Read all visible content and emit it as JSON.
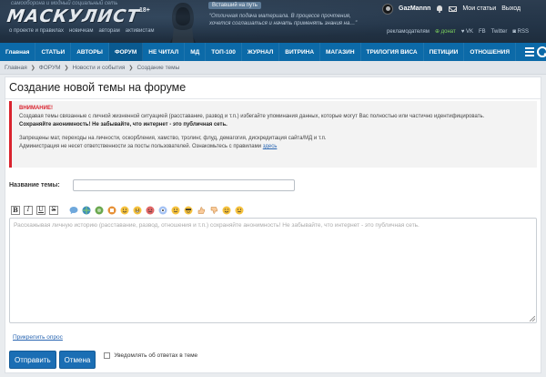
{
  "header": {
    "tagline": "самооборона и модный социальный сеть",
    "logo": "МАСКУЛИСТ",
    "logo_age": "18+",
    "links": [
      "о проекте и правилах",
      "новичкам",
      "авторам",
      "активистам"
    ],
    "quote_badge": "Вставший на путь",
    "quote": "“Отличная подача материала. В процессе прочтения, хочется соглашаться и начать применять знания на…”",
    "user_name": "GazMannn",
    "my_posts": "Мои статьи",
    "logout": "Выход",
    "meta_links": [
      "рекламодателям",
      "донат",
      "VK",
      "FB",
      "Twitter",
      "RSS"
    ]
  },
  "nav": {
    "items": [
      "Главная",
      "СТАТЬИ",
      "АВТОРЫ",
      "ФОРУМ",
      "НЕ ЧИТАЛ",
      "МД",
      "ТОП-100",
      "ЖУРНАЛ",
      "ВИТРИНА",
      "МАГАЗИН",
      "ТРИЛОГИЯ ВИСА",
      "ПЕТИЦИИ",
      "ОТНОШЕНИЯ"
    ],
    "active_index": 3
  },
  "breadcrumb": [
    "Главная",
    "ФОРУМ",
    "Новости и события",
    "Создание темы"
  ],
  "page": {
    "title": "Создание новой темы на форуме"
  },
  "warning": {
    "title": "ВНИМАНИЕ!",
    "line1": "Создавая темы связанные с личной жизненной ситуацией (расставание, развод и т.п.) избегайте упоминания данных, которые могут Вас полностью или частично идентифицировать.",
    "line2": "Сохраняйте анонимность! Не забывайте, что интернет - это публичная сеть.",
    "line3": "Запрещены мат, переходы на личности, оскорбления, хамство, тролинг, флуд, демагогия, дискредитация сайта/МД и т.п.",
    "line4": "Администрация не несет ответственности за посты пользователей. Ознакомьтесь с правилами",
    "link": "здесь"
  },
  "form": {
    "title_label": "Название темы:",
    "title_value": "",
    "editor_placeholder": "Расскажывая личную историю (расставание, развод, отношения и т.п.) сохраняйте анонимность! Не забывайте, что интернет - это публичная сеть.",
    "toolbar_buttons": [
      "B",
      "I",
      "U",
      "S"
    ],
    "poll_link": "Прикрепить опрос",
    "submit": "Отправить",
    "cancel": "Отмена",
    "notify_label": "Уведомлять об ответах в теме"
  },
  "colors": {
    "nav_bg": "#0c6aa8",
    "warning_accent": "#d9232e",
    "link": "#2b67b3",
    "button": "#1b6eb4"
  }
}
